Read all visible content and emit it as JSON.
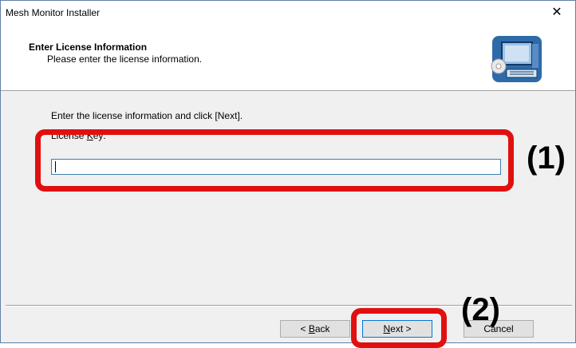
{
  "window": {
    "title": "Mesh Monitor Installer",
    "close_glyph": "✕"
  },
  "header": {
    "title": "Enter License Information",
    "subtitle": "Please enter the license information.",
    "icon": "computer-disc-icon"
  },
  "content": {
    "instruction": "Enter the license information and click [Next].",
    "license_key": {
      "label_prefix": "License ",
      "label_mnemonic": "K",
      "label_suffix": "ey:",
      "value": ""
    }
  },
  "buttons": {
    "back": {
      "prefix": "< ",
      "mnemonic": "B",
      "suffix": "ack"
    },
    "next": {
      "prefix": "",
      "mnemonic": "N",
      "suffix": "ext >"
    },
    "cancel": {
      "label": "Cancel"
    }
  },
  "annotations": {
    "label_1": "(1)",
    "label_2": "(2)"
  },
  "colors": {
    "annotation": "#e01010",
    "input_border": "#3c7fb1",
    "default_button_border": "#0078d7"
  }
}
